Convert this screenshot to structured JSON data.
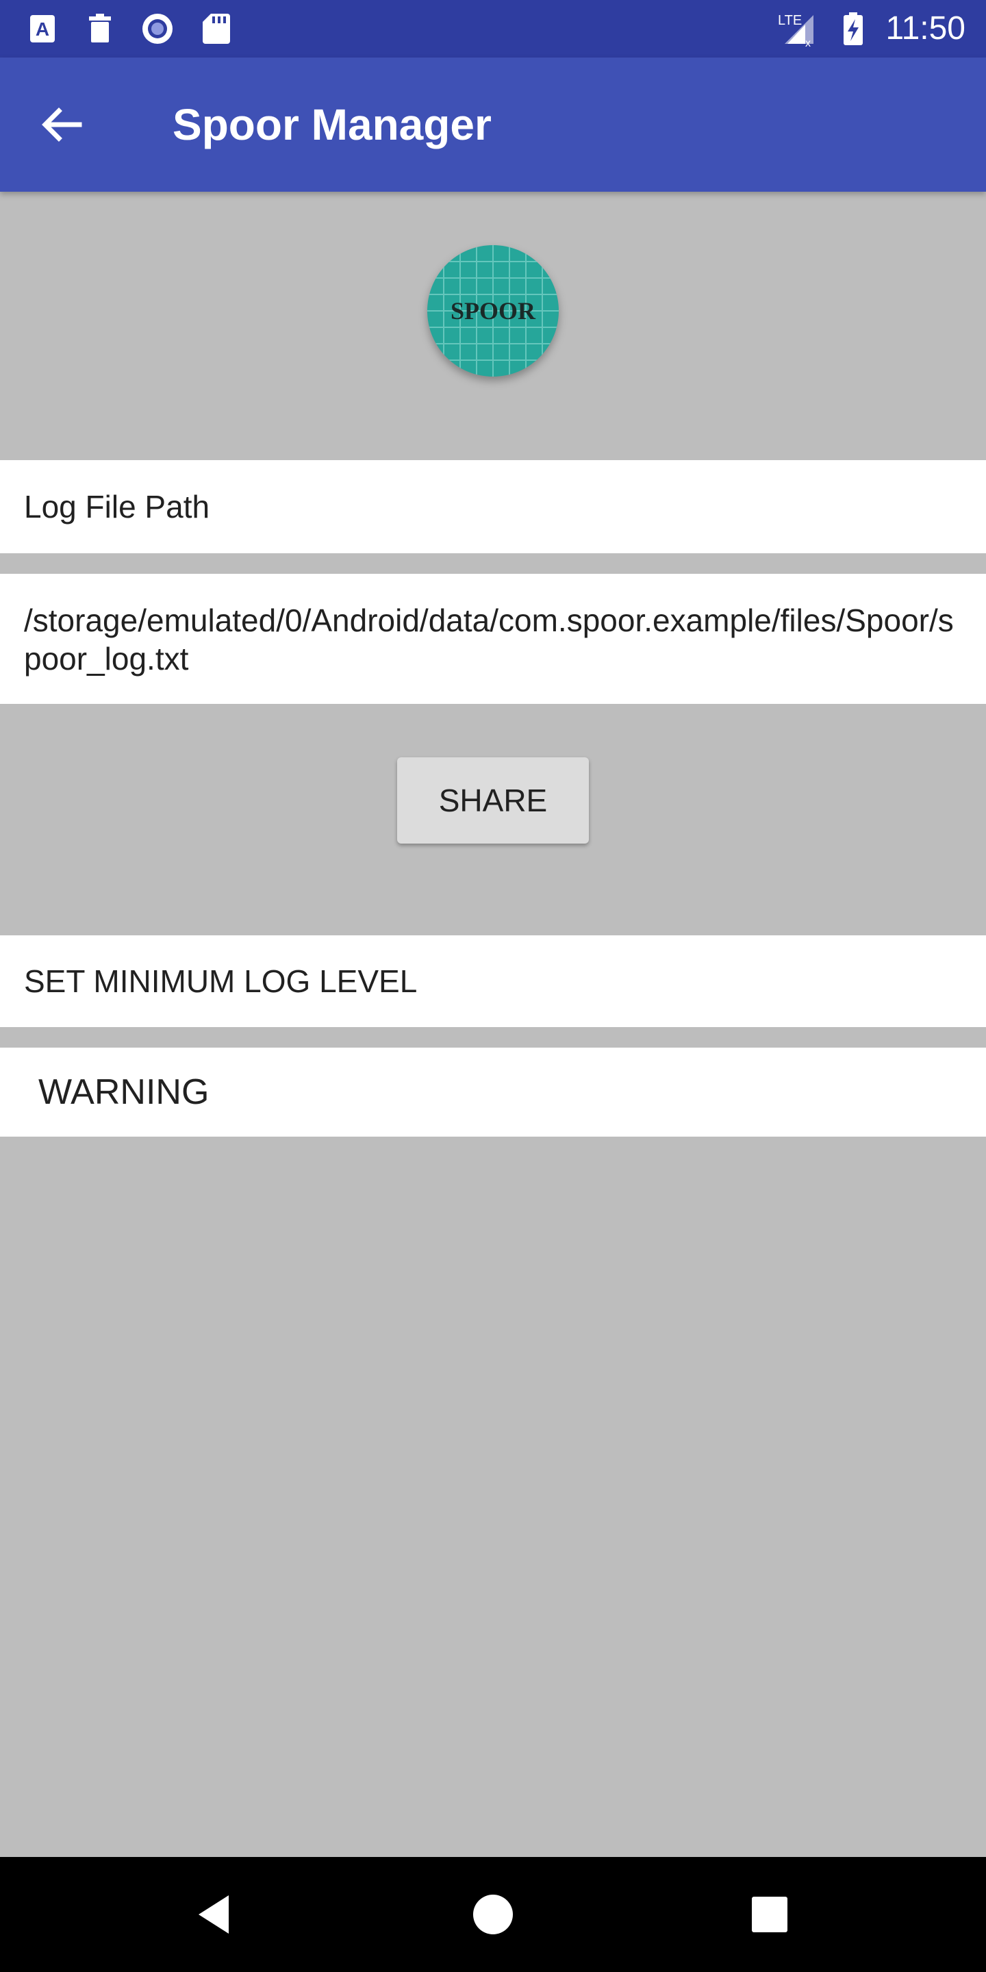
{
  "status_bar": {
    "time": "11:50",
    "icons": [
      "text-a-icon",
      "trash-icon",
      "record-icon",
      "sd-card-icon",
      "lte-signal-icon",
      "battery-charging-icon"
    ]
  },
  "app_bar": {
    "title": "Spoor Manager",
    "back_icon": "arrow-back-icon"
  },
  "logo": {
    "text": "SPOOR",
    "color": "#26a69a"
  },
  "log_file": {
    "label": "Log File Path",
    "path": "/storage/emulated/0/Android/data/com.spoor.example/files/Spoor/spoor_log.txt"
  },
  "share_button": {
    "label": "SHARE"
  },
  "log_level": {
    "label": "SET MINIMUM LOG LEVEL",
    "selected": "WARNING"
  },
  "nav_bar": {
    "icons": [
      "back-triangle-icon",
      "home-circle-icon",
      "recents-square-icon"
    ]
  },
  "colors": {
    "status_bar": "#2f3da0",
    "app_bar": "#3f51b5",
    "background": "#bdbdbd"
  }
}
